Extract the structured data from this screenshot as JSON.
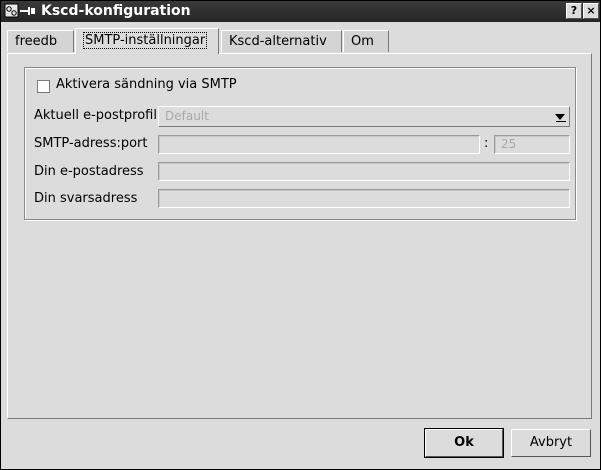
{
  "window": {
    "title": "Kscd-konfiguration",
    "help_button": "?",
    "close_button": "×"
  },
  "tabs": [
    {
      "label": "freedb",
      "active": false
    },
    {
      "label": "SMTP-inställningar",
      "active": true
    },
    {
      "label": "Kscd-alternativ",
      "active": false
    },
    {
      "label": "Om",
      "active": false
    }
  ],
  "smtp": {
    "enable_checkbox_label": "Aktivera sändning via SMTP",
    "enable_checked": false,
    "profile_label": "Aktuell e-postprofil",
    "profile_value": "Default",
    "address_label": "SMTP-adress:port",
    "address_value": "",
    "port_separator": ":",
    "port_value": "25",
    "email_label": "Din e-postadress",
    "email_value": "",
    "reply_label": "Din svarsadress",
    "reply_value": ""
  },
  "buttons": {
    "ok": "Ok",
    "cancel": "Avbryt"
  }
}
